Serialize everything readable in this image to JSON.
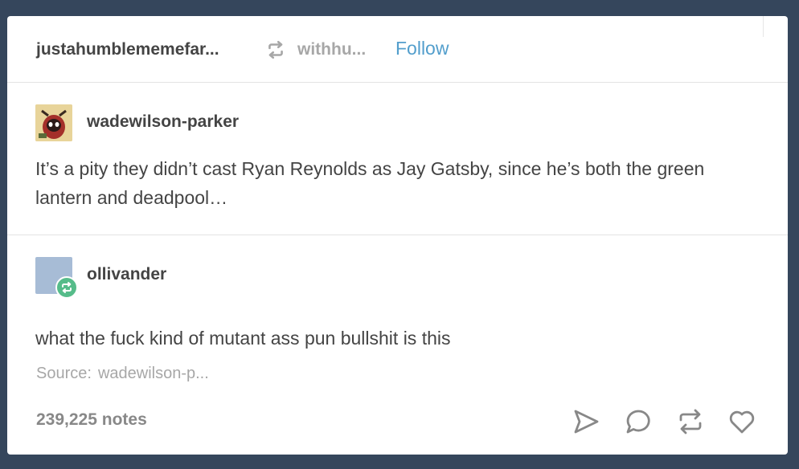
{
  "header": {
    "blog_name": "justahumblememefar...",
    "via_name": "withhu...",
    "follow_label": "Follow"
  },
  "trail": [
    {
      "username": "wadewilson-parker",
      "text": "It’s a pity they didn’t cast Ryan Reynolds as Jay Gatsby, since he’s both the green lantern and deadpool…"
    },
    {
      "username": "ollivander",
      "text": "what the fuck kind of mutant ass pun bullshit is this"
    }
  ],
  "footer": {
    "source_label": "Source:",
    "source_value": "wadewilson-p...",
    "notes": "239,225 notes"
  },
  "actions": [
    "share-icon",
    "reply-icon",
    "reblog-icon",
    "like-icon"
  ],
  "colors": {
    "background": "#35465c",
    "link": "#529ecc",
    "text": "#444444",
    "muted": "#a7a7a7",
    "reblog_badge": "#56bc8a"
  }
}
